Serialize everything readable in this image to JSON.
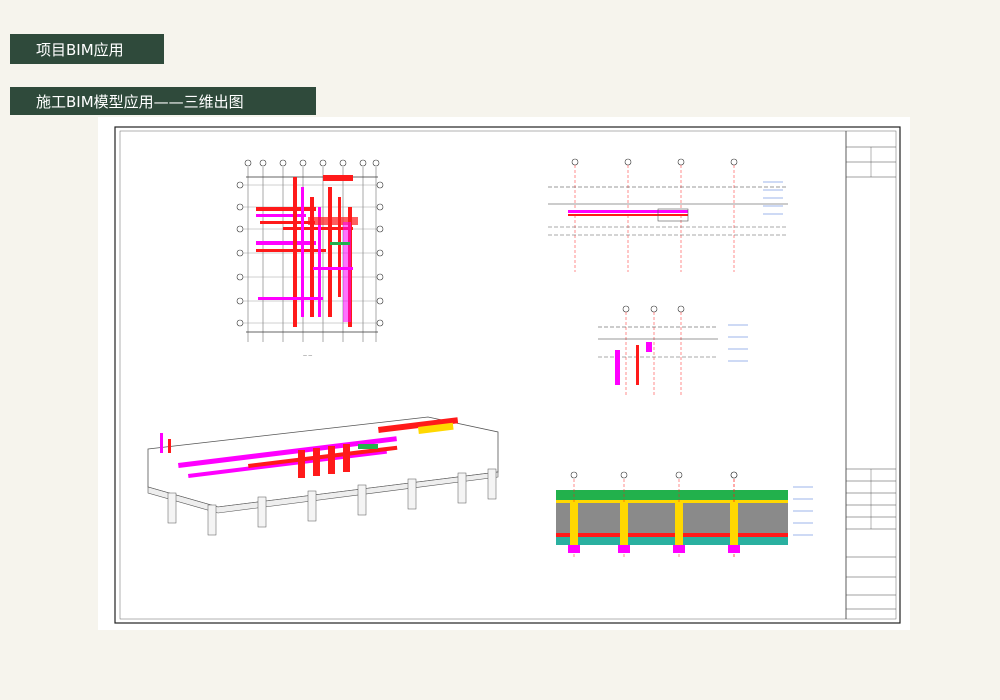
{
  "banners": {
    "section_title": "项目BIM应用",
    "subsection_title": "施工BIM模型应用——三维出图"
  },
  "colors": {
    "banner_bg": "#2f4a3b",
    "page_bg": "#f6f4ed",
    "pipe_magenta": "#ff00ff",
    "pipe_red": "#ff1a1a",
    "pipe_yellow": "#ffd800",
    "pipe_green": "#22b14c"
  }
}
